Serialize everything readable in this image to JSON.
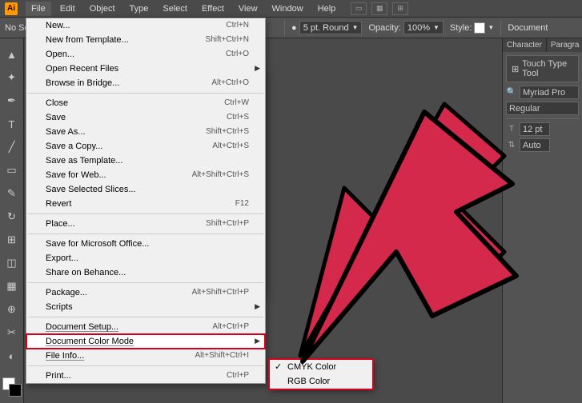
{
  "app": {
    "logo": "Ai"
  },
  "menubar": [
    "File",
    "Edit",
    "Object",
    "Type",
    "Select",
    "Effect",
    "View",
    "Window",
    "Help"
  ],
  "controlbar": {
    "noselect": "No Sel",
    "stroke": "5 pt. Round",
    "opacity_label": "Opacity:",
    "opacity": "100%",
    "style_label": "Style:",
    "docsetup": "Document"
  },
  "menu": [
    {
      "label": "New...",
      "shortcut": "Ctrl+N"
    },
    {
      "label": "New from Template...",
      "shortcut": "Shift+Ctrl+N"
    },
    {
      "label": "Open...",
      "shortcut": "Ctrl+O"
    },
    {
      "label": "Open Recent Files",
      "submenu": true
    },
    {
      "label": "Browse in Bridge...",
      "shortcut": "Alt+Ctrl+O"
    },
    {
      "sep": true
    },
    {
      "label": "Close",
      "shortcut": "Ctrl+W"
    },
    {
      "label": "Save",
      "shortcut": "Ctrl+S"
    },
    {
      "label": "Save As...",
      "shortcut": "Shift+Ctrl+S"
    },
    {
      "label": "Save a Copy...",
      "shortcut": "Alt+Ctrl+S"
    },
    {
      "label": "Save as Template..."
    },
    {
      "label": "Save for Web...",
      "shortcut": "Alt+Shift+Ctrl+S"
    },
    {
      "label": "Save Selected Slices..."
    },
    {
      "label": "Revert",
      "shortcut": "F12"
    },
    {
      "sep": true
    },
    {
      "label": "Place...",
      "shortcut": "Shift+Ctrl+P"
    },
    {
      "sep": true
    },
    {
      "label": "Save for Microsoft Office..."
    },
    {
      "label": "Export..."
    },
    {
      "label": "Share on Behance..."
    },
    {
      "sep": true
    },
    {
      "label": "Package...",
      "shortcut": "Alt+Shift+Ctrl+P"
    },
    {
      "label": "Scripts",
      "submenu": true
    },
    {
      "sep": true
    },
    {
      "label": "Document Setup...",
      "shortcut": "Alt+Ctrl+P",
      "underline": true
    },
    {
      "label": "Document Color Mode",
      "submenu": true,
      "underline": true,
      "highlighted": true
    },
    {
      "label": "File Info...",
      "shortcut": "Alt+Shift+Ctrl+I",
      "underline": true
    },
    {
      "sep": true
    },
    {
      "label": "Print...",
      "shortcut": "Ctrl+P"
    }
  ],
  "submenu": [
    {
      "label": "CMYK Color",
      "checked": true
    },
    {
      "label": "RGB Color"
    }
  ],
  "panels": {
    "tabs": [
      "Character",
      "Paragra"
    ],
    "touch": "Touch Type Tool",
    "font": "Myriad Pro",
    "style": "Regular",
    "size": "12 pt",
    "leading": "Auto"
  },
  "tools": [
    "▲",
    "✦",
    "✒",
    "T",
    "╱",
    "▭",
    "✎",
    "↻",
    "⊞",
    "◫",
    "▦",
    "⊕",
    "✂",
    "◐"
  ]
}
